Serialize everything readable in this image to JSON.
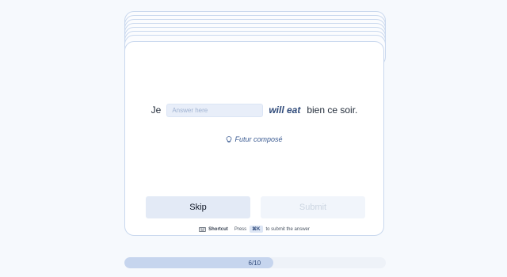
{
  "sentence": {
    "prefix": "Je",
    "answer_placeholder": "Answer here",
    "answer_value": "",
    "verb_hint": "will eat",
    "suffix": "bien ce soir."
  },
  "hint": {
    "icon": "lightbulb-icon",
    "text": "Futur composé"
  },
  "buttons": {
    "skip_label": "Skip",
    "submit_label": "Submit"
  },
  "shortcut": {
    "icon": "keyboard-icon",
    "label": "Shortcut",
    "press": "Press",
    "key": "⌘K",
    "rest": "to submit the answer"
  },
  "progress": {
    "label": "6/10",
    "current": 6,
    "total": 10
  },
  "colors": {
    "accent": "#2f4a7a",
    "card_border": "#c9d8ee",
    "background": "#f6f9fd"
  }
}
